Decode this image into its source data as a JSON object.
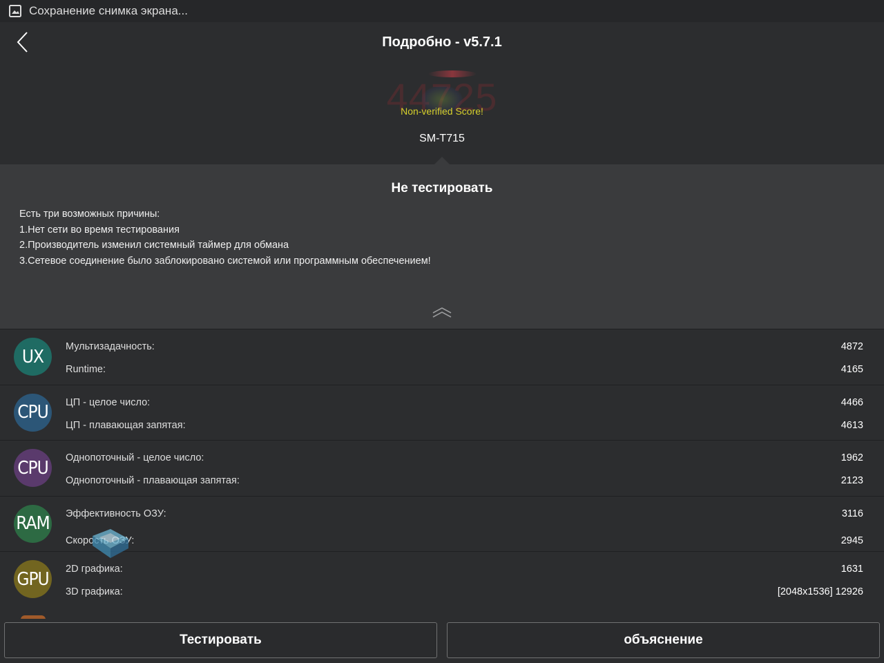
{
  "status_bar": {
    "icon": "image-icon",
    "text": "Сохранение снимка экрана..."
  },
  "header": {
    "back_icon": "chevron-left-icon",
    "title": "Подробно - v5.7.1",
    "score": "44725",
    "score_note": "Non-verified Score!",
    "device": "SM-T715"
  },
  "notice": {
    "title": "Не тестировать",
    "lines": [
      "Есть три возможных причины:",
      "1.Нет сети во время тестирования",
      "2.Производитель изменил системный таймер для обмана",
      "3.Сетевое соединение было заблокировано системой или программным обеспечением!"
    ],
    "collapse_icon": "double-chevron-up-icon"
  },
  "results": [
    {
      "badge": "UX",
      "badge_color": "#1f6b63",
      "items": [
        {
          "label": "Мультизадачность:",
          "value": "4872"
        },
        {
          "label": "Runtime:",
          "value": "4165"
        }
      ]
    },
    {
      "badge": "CPU",
      "badge_color": "#2c5677",
      "items": [
        {
          "label": "ЦП - целое число:",
          "value": "4466"
        },
        {
          "label": "ЦП - плавающая запятая:",
          "value": "4613"
        }
      ]
    },
    {
      "badge": "CPU",
      "badge_color": "#5a3a6c",
      "items": [
        {
          "label": "Однопоточный - целое число:",
          "value": "1962"
        },
        {
          "label": "Однопоточный - плавающая запятая:",
          "value": "2123"
        }
      ]
    },
    {
      "badge": "RAM",
      "badge_color": "#2d6a43",
      "items": [
        {
          "label": "Эффективность ОЗУ:",
          "value": "3116"
        },
        {
          "label": "Скорость ОЗУ:",
          "value": "2945"
        }
      ]
    },
    {
      "badge": "GPU",
      "badge_color": "#726520",
      "items": [
        {
          "label": "2D графика:",
          "value": "1631"
        },
        {
          "label": "3D графика:",
          "value": "[2048x1536] 12926"
        }
      ]
    }
  ],
  "buttons": {
    "test": "Тестировать",
    "explain": "объяснение"
  }
}
